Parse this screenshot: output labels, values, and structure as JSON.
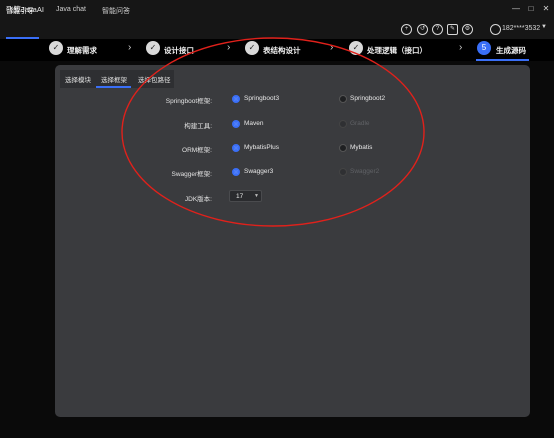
{
  "app": {
    "title": "飞算JavaAI"
  },
  "window_controls": [
    "—",
    "□",
    "✕"
  ],
  "nav": {
    "tabs": [
      {
        "label": "智能引导",
        "active": true
      },
      {
        "label": "Java chat",
        "active": false
      },
      {
        "label": "智能问答",
        "active": false
      }
    ]
  },
  "toolbar": {
    "icons": [
      "add-icon",
      "history-icon",
      "help-icon",
      "edit-icon",
      "settings-icon"
    ],
    "user_phone": "182****3532"
  },
  "steps": [
    {
      "label": "理解需求",
      "status": "done"
    },
    {
      "label": "设计接口",
      "status": "done"
    },
    {
      "label": "表结构设计",
      "status": "done"
    },
    {
      "label": "处理逻辑（接口）",
      "status": "done"
    },
    {
      "label": "生成源码",
      "status": "current",
      "number": "5"
    }
  ],
  "subtabs": [
    {
      "label": "选择模块",
      "active": false
    },
    {
      "label": "选择框架",
      "active": true
    },
    {
      "label": "选择包路径",
      "active": false
    }
  ],
  "framework_form": [
    {
      "label": "Springboot框架:",
      "options": [
        {
          "label": "Springboot3",
          "state": "selected"
        },
        {
          "label": "Springboot2",
          "state": "unselected"
        }
      ]
    },
    {
      "label": "构建工具:",
      "options": [
        {
          "label": "Maven",
          "state": "selected"
        },
        {
          "label": "Gradle",
          "state": "disabled"
        }
      ]
    },
    {
      "label": "ORM框架:",
      "options": [
        {
          "label": "MybatisPlus",
          "state": "selected"
        },
        {
          "label": "Mybatis",
          "state": "unselected"
        }
      ]
    },
    {
      "label": "Swagger框架:",
      "options": [
        {
          "label": "Swagger3",
          "state": "selected"
        },
        {
          "label": "Swagger2",
          "state": "disabled"
        }
      ]
    }
  ],
  "jdk": {
    "label": "JDK版本:",
    "value": "17"
  },
  "colors": {
    "accent": "#3a6ff7",
    "annotation": "#e0211b",
    "card": "#3a3b3e",
    "background": "#0a0a0a"
  }
}
